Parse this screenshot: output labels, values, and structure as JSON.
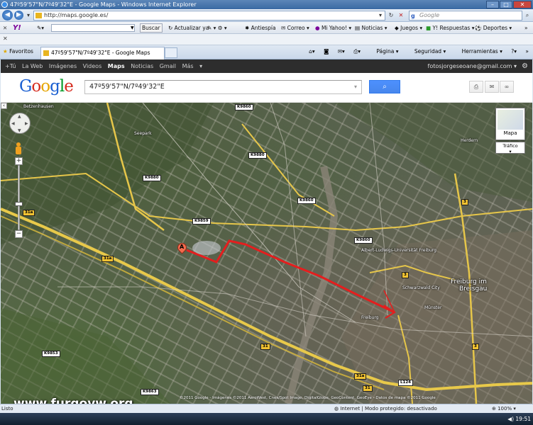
{
  "window": {
    "title": "47º59'57\"N/7º49'32\"E - Google Maps - Windows Internet Explorer"
  },
  "address_bar": {
    "url": "http://maps.google.es/",
    "search_placeholder": "Google"
  },
  "yahoo_toolbar": {
    "logo": "Y!",
    "search_button": "Buscar",
    "items": [
      "Actualizar ya",
      "Antiespía",
      "Correo",
      "Mi Yahoo!",
      "Noticias",
      "Juegos",
      "Y! Respuestas",
      "Deportes"
    ]
  },
  "tabs": {
    "favorites_label": "Favoritos",
    "active_tab": "47º59'57\"N/7º49'32\"E - Google Maps",
    "tools": [
      "Página",
      "Seguridad",
      "Herramientas"
    ]
  },
  "google_bar": {
    "links": [
      "+Tú",
      "La Web",
      "Imágenes",
      "Videos",
      "Maps",
      "Noticias",
      "Gmail",
      "Más"
    ],
    "selected": "Maps",
    "user": "fotosjorgeseoane@gmail.com"
  },
  "search": {
    "query": "47º59'57\"N/7º49'32\"E"
  },
  "map": {
    "map_type_label": "Mapa",
    "traffic_label": "Tráfico",
    "marker_letter": "A",
    "city_label_1": "Freiburg im",
    "city_label_2": "Breisgau",
    "place_labels": [
      "Betzenhausen",
      "Seepark",
      "Herdern",
      "Albert-Ludwigs-Universität Freiburg",
      "Freiburg",
      "Schwarzwald City",
      "Münster"
    ],
    "road_shields": [
      "K9860",
      "K9880",
      "K9880",
      "K9860",
      "K9859",
      "K9860",
      "31a",
      "31a",
      "31",
      "31a",
      "3",
      "3",
      "3",
      "K9853",
      "K9863",
      "L124",
      "31"
    ],
    "route_color": "#e41e1e",
    "copyright": "©2011 Google - Imágenes ©2011 AeroWest, Cnes/Spot Image, DigitalGlobe, GeoContent, GeoEye - Datos de mapa ©2011 Google"
  },
  "watermark": "www.furgovw.org",
  "status": {
    "left": "Listo",
    "zone": "Internet | Modo protegido: desactivado",
    "zoom": "100%"
  },
  "taskbar": {
    "clock": "19:51"
  }
}
